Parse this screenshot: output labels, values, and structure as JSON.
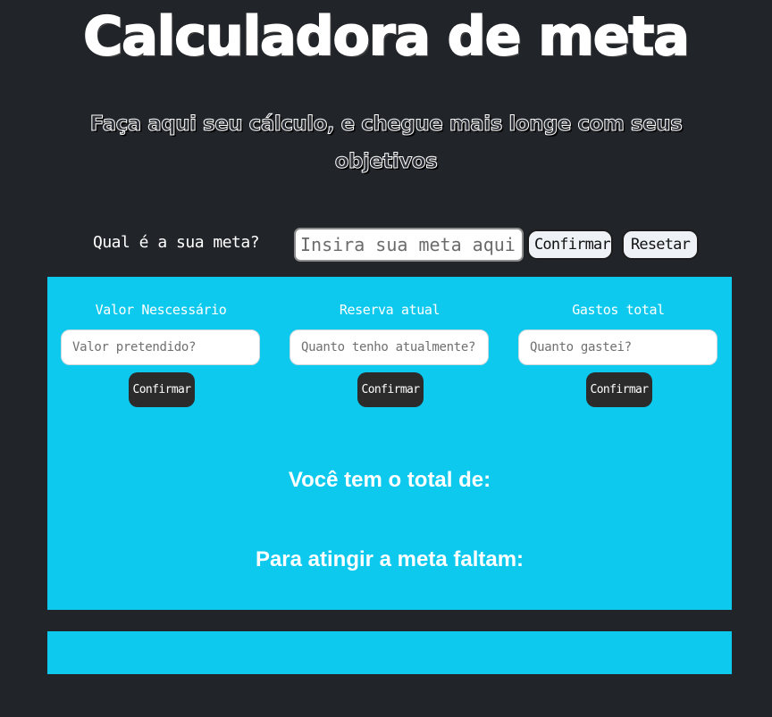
{
  "header": {
    "title": "Calculadora de meta",
    "subtitle": "Faça aqui seu cálculo, e chegue mais longe com seus objetivos"
  },
  "meta": {
    "label": "Qual é a sua meta?",
    "placeholder": "Insira sua meta aqui!",
    "confirm_label": "Confirmar",
    "reset_label": "Resetar"
  },
  "panel": {
    "columns": [
      {
        "label": "Valor Nescessário",
        "placeholder": "Valor pretendido?",
        "button": "Confirmar"
      },
      {
        "label": "Reserva atual",
        "placeholder": "Quanto tenho atualmente?",
        "button": "Confirmar"
      },
      {
        "label": "Gastos total",
        "placeholder": "Quanto gastei?",
        "button": "Confirmar"
      }
    ],
    "total_text": "Você tem o total de:",
    "remaining_text": "Para atingir a meta faltam:"
  },
  "colors": {
    "background": "#212429",
    "panel": "#0ec9ee",
    "dark_button": "#2b2b2b"
  }
}
